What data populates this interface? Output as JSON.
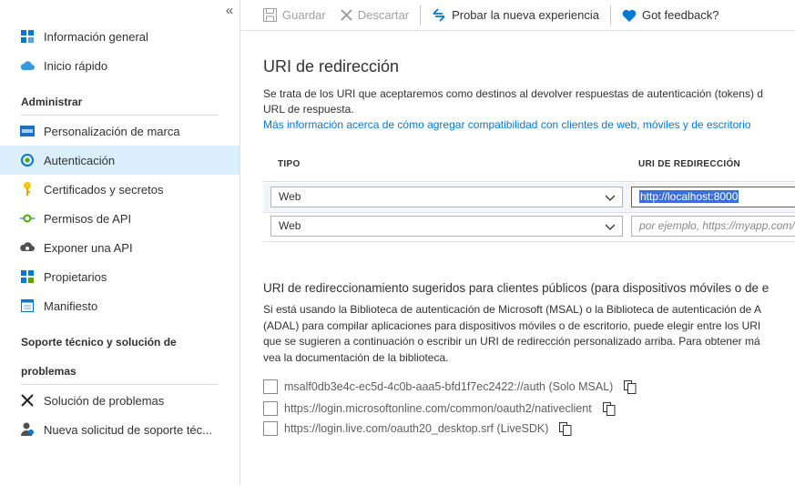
{
  "sidebar": {
    "collapse_glyph": "«",
    "items_top": [
      {
        "label": "Información general",
        "icon": "grid-icon"
      },
      {
        "label": "Inicio rápido",
        "icon": "cloud-icon"
      }
    ],
    "section_manage": "Administrar",
    "items_manage": [
      {
        "label": "Personalización de marca",
        "icon": "branding-icon"
      },
      {
        "label": "Autenticación",
        "icon": "authentication-icon"
      },
      {
        "label": "Certificados y secretos",
        "icon": "key-icon"
      },
      {
        "label": "Permisos de API",
        "icon": "api-permissions-icon"
      },
      {
        "label": "Exponer una API",
        "icon": "cloud-expose-icon"
      },
      {
        "label": "Propietarios",
        "icon": "owners-icon"
      },
      {
        "label": "Manifiesto",
        "icon": "manifest-icon"
      }
    ],
    "section_support_line1": "Soporte técnico y solución de",
    "section_support_line2": "problemas",
    "items_support": [
      {
        "label": "Solución de problemas",
        "icon": "tools-icon"
      },
      {
        "label": "Nueva solicitud de soporte téc...",
        "icon": "support-request-icon"
      }
    ]
  },
  "toolbar": {
    "save_label": "Guardar",
    "discard_label": "Descartar",
    "try_label": "Probar la nueva experiencia",
    "feedback_label": "Got feedback?"
  },
  "redirect": {
    "title": "URI de redirección",
    "desc_line1": "Se trata de los URI que aceptaremos como destinos al devolver respuestas de autenticación (tokens) d",
    "desc_line2": "URL de respuesta.",
    "link": "Más información acerca de cómo agregar compatibilidad con clientes de web, móviles y de escritorio",
    "col_type": "TIPO",
    "col_uri": "URI DE REDIRECCIÓN",
    "rows": [
      {
        "type": "Web",
        "uri": "http://localhost:8000"
      },
      {
        "type": "Web",
        "placeholder": "por ejemplo, https://myapp.com/"
      }
    ]
  },
  "public_clients": {
    "title": "URI de redireccionamiento sugeridos para clientes públicos (para dispositivos móviles o de e",
    "desc_lines": [
      "Si está usando la Biblioteca de autenticación de Microsoft (MSAL) o la Biblioteca de autenticación de A",
      "(ADAL) para compilar aplicaciones para dispositivos móviles o de escritorio, puede elegir entre los URI",
      "que se sugieren a continuación o escribir un URI de redirección personalizado arriba. Para obtener má",
      "vea la documentación de la biblioteca."
    ],
    "options": [
      "msalf0db3e4c-ec5d-4c0b-aaa5-bfd1f7ec2422://auth (Solo MSAL)",
      "https://login.microsoftonline.com/common/oauth2/nativeclient",
      "https://login.live.com/oauth20_desktop.srf (LiveSDK)"
    ]
  },
  "colors": {
    "accent": "#0078d4",
    "active_nav": "#dbeefb",
    "selection": "#3b6fd6"
  }
}
